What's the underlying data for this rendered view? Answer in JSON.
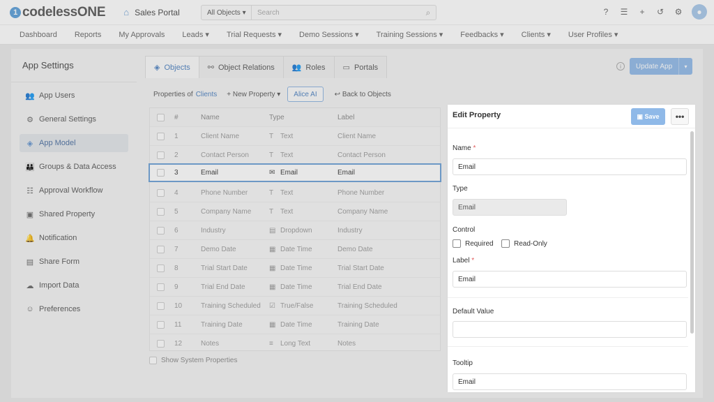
{
  "brand": {
    "logo_mark": "1",
    "logo_text": "codelessONE"
  },
  "portal": {
    "name": "Sales Portal",
    "icon": "building-icon"
  },
  "search": {
    "scope": "All Objects",
    "placeholder": "Search"
  },
  "nav": [
    "Dashboard",
    "Reports",
    "My Approvals",
    "Leads ▾",
    "Trial Requests ▾",
    "Demo Sessions ▾",
    "Training Sessions ▾",
    "Feedbacks ▾",
    "Clients ▾",
    "User Profiles ▾"
  ],
  "sidebar": {
    "title": "App Settings",
    "items": [
      {
        "label": "App Users",
        "icon": "users-icon"
      },
      {
        "label": "General Settings",
        "icon": "gear-icon"
      },
      {
        "label": "App Model",
        "icon": "cube-icon",
        "active": true
      },
      {
        "label": "Groups & Data Access",
        "icon": "group-icon"
      },
      {
        "label": "Approval Workflow",
        "icon": "list-check-icon"
      },
      {
        "label": "Shared Property",
        "icon": "shared-icon"
      },
      {
        "label": "Notification",
        "icon": "bell-icon"
      },
      {
        "label": "Share Form",
        "icon": "form-icon"
      },
      {
        "label": "Import Data",
        "icon": "cloud-upload-icon"
      },
      {
        "label": "Preferences",
        "icon": "user-cog-icon"
      }
    ]
  },
  "tabs": [
    {
      "label": "Objects",
      "active": true
    },
    {
      "label": "Object Relations"
    },
    {
      "label": "Roles"
    },
    {
      "label": "Portals"
    }
  ],
  "update_app": {
    "label": "Update App"
  },
  "toolbar": {
    "properties_of": "Properties of",
    "object": "Clients",
    "new_property": "+ New Property ▾",
    "alice": "Alice AI",
    "back": "Back to Objects"
  },
  "table": {
    "headers": {
      "num": "#",
      "name": "Name",
      "type": "Type",
      "label": "Label"
    },
    "rows": [
      {
        "num": "1",
        "name": "Client Name",
        "type": "Text",
        "label": "Client Name"
      },
      {
        "num": "2",
        "name": "Contact Person",
        "type": "Text",
        "label": "Contact Person"
      },
      {
        "num": "3",
        "name": "Email",
        "type": "Email",
        "label": "Email",
        "selected": true
      },
      {
        "num": "4",
        "name": "Phone Number",
        "type": "Text",
        "label": "Phone Number"
      },
      {
        "num": "5",
        "name": "Company Name",
        "type": "Text",
        "label": "Company Name"
      },
      {
        "num": "6",
        "name": "Industry",
        "type": "Dropdown",
        "label": "Industry"
      },
      {
        "num": "7",
        "name": "Demo Date",
        "type": "Date Time",
        "label": "Demo Date"
      },
      {
        "num": "8",
        "name": "Trial Start Date",
        "type": "Date Time",
        "label": "Trial Start Date"
      },
      {
        "num": "9",
        "name": "Trial End Date",
        "type": "Date Time",
        "label": "Trial End Date"
      },
      {
        "num": "10",
        "name": "Training Scheduled",
        "type": "True/False",
        "label": "Training Scheduled"
      },
      {
        "num": "11",
        "name": "Training Date",
        "type": "Date Time",
        "label": "Training Date"
      },
      {
        "num": "12",
        "name": "Notes",
        "type": "Long Text",
        "label": "Notes"
      }
    ],
    "show_system": "Show System Properties"
  },
  "edit": {
    "title": "Edit Property",
    "save": "Save",
    "more": "•••",
    "name_label": "Name",
    "name_value": "Email",
    "type_label": "Type",
    "type_value": "Email",
    "control_label": "Control",
    "required": "Required",
    "readonly": "Read-Only",
    "label_label": "Label",
    "label_value": "Email",
    "default_label": "Default Value",
    "default_value": "",
    "tooltip_label": "Tooltip",
    "tooltip_value": "Email",
    "asterisk": "*"
  }
}
